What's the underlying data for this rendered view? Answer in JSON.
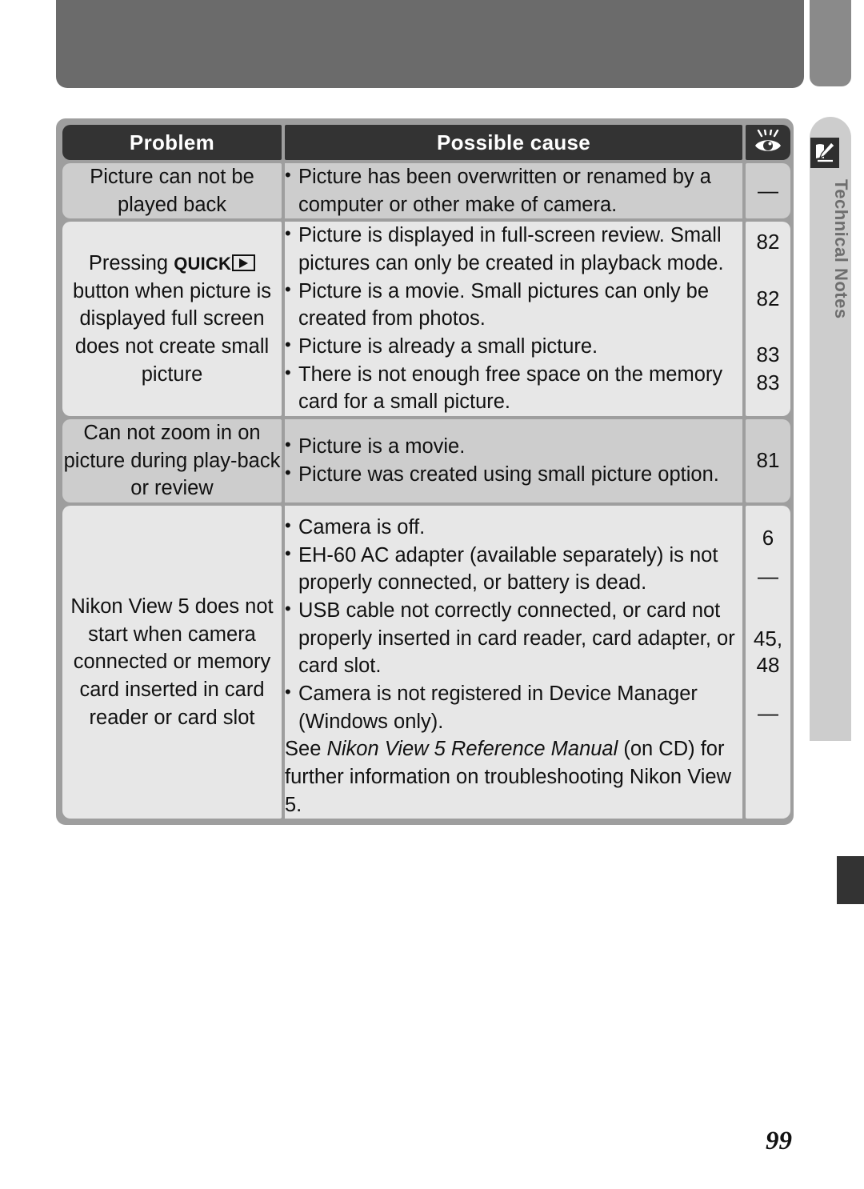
{
  "page": {
    "number": "99",
    "side_tab_label": "Technical Notes",
    "side_tab_icon": "pencil-notes-icon",
    "tab_marker_icon": "page-tab-marker"
  },
  "table": {
    "headers": {
      "problem": "Problem",
      "cause": "Possible cause",
      "page_icon": "eye-reference-icon"
    },
    "rows": [
      {
        "problem": "Picture can not be played back",
        "problem_has_quick_glyph": false,
        "causes": [
          "Picture has been overwritten or renamed by a computer or other make of camera."
        ],
        "pages": [
          "—"
        ]
      },
      {
        "problem_prefix": "Pressing",
        "problem_quick": "QUICK",
        "problem_suffix": "button when picture is displayed full screen does not create small picture",
        "problem_has_quick_glyph": true,
        "causes": [
          "Picture is displayed in full-screen review.  Small pictures can only be created in playback mode.",
          "Picture is a movie.  Small pictures can only be created from photos.",
          "Picture is already a small picture.",
          "There is not enough free space on the memory card for a small picture."
        ],
        "pages": [
          "82",
          "82",
          "83",
          "83"
        ]
      },
      {
        "problem": "Can not zoom in on picture during play-back or review",
        "problem_has_quick_glyph": false,
        "causes": [
          "Picture is a movie.",
          "Picture was created using small picture option."
        ],
        "pages": [
          "81"
        ]
      },
      {
        "problem": "Nikon View 5 does not start when camera connected or memory card inserted in card reader or card slot",
        "problem_has_quick_glyph": false,
        "causes": [
          "Camera is off.",
          "EH-60 AC adapter (available separately) is not properly connected, or battery is dead.",
          "USB cable not correctly connected, or card not properly inserted in card reader, card adapter, or card slot.",
          "Camera is not registered in Device Manager (Windows only)."
        ],
        "note_prefix": "See ",
        "note_italic": "Nikon View 5 Reference Manual",
        "note_suffix": " (on CD) for further information on troubleshooting Nikon View 5.",
        "pages": [
          "6",
          "—",
          "45,",
          "48",
          "—"
        ]
      }
    ]
  },
  "colors": {
    "header_bg": "#333333",
    "row_dark": "#cdcdcd",
    "row_light": "#e7e7e7",
    "frame": "#9e9e9e",
    "banner": "#6b6b6b",
    "tab_bg": "#cdcdcd"
  }
}
